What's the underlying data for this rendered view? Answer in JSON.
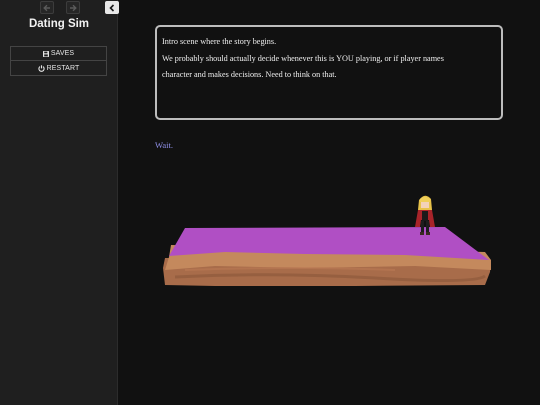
{
  "sidebar": {
    "title": "Dating Sim",
    "back_icon": "arrow-left-icon",
    "forward_icon": "arrow-right-icon",
    "collapse_icon": "chevron-left-icon",
    "saves_label": "SAVES",
    "saves_icon": "floppy-disk-icon",
    "restart_label": "RESTART",
    "restart_icon": "power-icon"
  },
  "passage": {
    "line1": "Intro scene where the story begins.",
    "line2": "We probably should actually decide whenever this is YOU playing, or if player names",
    "line3": "character and makes decisions. Need to think on that."
  },
  "link": {
    "label": "Wait."
  },
  "colors": {
    "background": "#111111",
    "sidebar": "#1f1f1f",
    "link": "#8f8fe8",
    "platform_top": "#b04fc4",
    "platform_edge": "#c4895d",
    "platform_side": "#a86c4a"
  }
}
